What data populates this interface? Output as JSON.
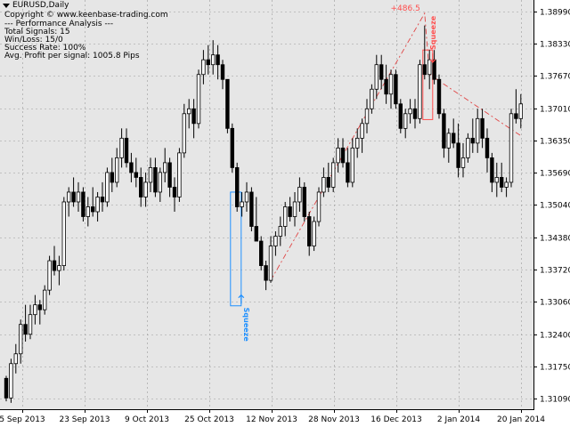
{
  "window": {
    "symbol_timeframe": "EURUSD,Daily"
  },
  "info_panel": {
    "copyright": "Copyright © www.keenbase-trading.com",
    "header": "--- Performance Analysis ---",
    "total_signals": "Total Signals: 15",
    "win_loss": "Win/Loss: 15/0",
    "success_rate": "Success Rate: 100%",
    "avg_profit": "Avg. Profit per signal: 1005.8 Pips"
  },
  "colors": {
    "background": "#e6e6e6",
    "grid": "#9a9a9a",
    "candle": "#000000",
    "bull_signal": "#1e90ff",
    "bear_signal": "#ff4d4d"
  },
  "chart_data": {
    "type": "candlestick",
    "title": "EURUSD,Daily",
    "x_tick_labels": [
      "5 Sep 2013",
      "23 Sep 2013",
      "9 Oct 2013",
      "25 Oct 2013",
      "12 Nov 2013",
      "28 Nov 2013",
      "16 Dec 2013",
      "2 Jan 2014",
      "20 Jan 2014"
    ],
    "y_tick_labels": [
      "1.38990",
      "1.38330",
      "1.37670",
      "1.37010",
      "1.36350",
      "1.35690",
      "1.35040",
      "1.34380",
      "1.33720",
      "1.33060",
      "1.32400",
      "1.31750",
      "1.31090"
    ],
    "y_ticks": [
      1.3899,
      1.3833,
      1.3767,
      1.3701,
      1.3635,
      1.3569,
      1.3504,
      1.3438,
      1.3372,
      1.3306,
      1.324,
      1.3175,
      1.3109
    ],
    "ylim": [
      1.3087,
      1.3922
    ],
    "grid": true,
    "candles": [
      [
        1.315,
        1.3155,
        1.3103,
        1.311
      ],
      [
        1.311,
        1.319,
        1.31,
        1.318
      ],
      [
        1.318,
        1.322,
        1.316,
        1.32
      ],
      [
        1.32,
        1.327,
        1.318,
        1.326
      ],
      [
        1.326,
        1.33,
        1.3225,
        1.324
      ],
      [
        1.324,
        1.33,
        1.323,
        1.328
      ],
      [
        1.328,
        1.332,
        1.326,
        1.33
      ],
      [
        1.33,
        1.331,
        1.326,
        1.329
      ],
      [
        1.329,
        1.334,
        1.328,
        1.333
      ],
      [
        1.333,
        1.34,
        1.332,
        1.339
      ],
      [
        1.339,
        1.342,
        1.336,
        1.337
      ],
      [
        1.337,
        1.34,
        1.334,
        1.338
      ],
      [
        1.338,
        1.352,
        1.337,
        1.351
      ],
      [
        1.351,
        1.354,
        1.348,
        1.353
      ],
      [
        1.353,
        1.356,
        1.35,
        1.351
      ],
      [
        1.351,
        1.355,
        1.349,
        1.353
      ],
      [
        1.353,
        1.354,
        1.347,
        1.348
      ],
      [
        1.348,
        1.352,
        1.346,
        1.35
      ],
      [
        1.35,
        1.354,
        1.348,
        1.349
      ],
      [
        1.349,
        1.353,
        1.347,
        1.352
      ],
      [
        1.352,
        1.355,
        1.349,
        1.351
      ],
      [
        1.351,
        1.358,
        1.35,
        1.357
      ],
      [
        1.357,
        1.36,
        1.353,
        1.355
      ],
      [
        1.355,
        1.362,
        1.354,
        1.36
      ],
      [
        1.36,
        1.366,
        1.358,
        1.364
      ],
      [
        1.364,
        1.366,
        1.358,
        1.359
      ],
      [
        1.359,
        1.361,
        1.355,
        1.357
      ],
      [
        1.357,
        1.36,
        1.354,
        1.356
      ],
      [
        1.356,
        1.358,
        1.35,
        1.352
      ],
      [
        1.352,
        1.357,
        1.35,
        1.355
      ],
      [
        1.355,
        1.36,
        1.353,
        1.358
      ],
      [
        1.358,
        1.36,
        1.352,
        1.353
      ],
      [
        1.353,
        1.358,
        1.351,
        1.357
      ],
      [
        1.357,
        1.362,
        1.355,
        1.359
      ],
      [
        1.359,
        1.36,
        1.352,
        1.354
      ],
      [
        1.354,
        1.356,
        1.349,
        1.352
      ],
      [
        1.352,
        1.362,
        1.351,
        1.361
      ],
      [
        1.361,
        1.371,
        1.36,
        1.369
      ],
      [
        1.369,
        1.372,
        1.366,
        1.37
      ],
      [
        1.37,
        1.372,
        1.364,
        1.367
      ],
      [
        1.367,
        1.378,
        1.366,
        1.377
      ],
      [
        1.377,
        1.382,
        1.375,
        1.38
      ],
      [
        1.38,
        1.383,
        1.377,
        1.379
      ],
      [
        1.379,
        1.384,
        1.377,
        1.381
      ],
      [
        1.381,
        1.383,
        1.376,
        1.379
      ],
      [
        1.379,
        1.38,
        1.374,
        1.376
      ],
      [
        1.376,
        1.376,
        1.365,
        1.366
      ],
      [
        1.366,
        1.367,
        1.357,
        1.358
      ],
      [
        1.358,
        1.359,
        1.349,
        1.35
      ],
      [
        1.35,
        1.353,
        1.348,
        1.351
      ],
      [
        1.351,
        1.355,
        1.349,
        1.353
      ],
      [
        1.353,
        1.354,
        1.345,
        1.346
      ],
      [
        1.346,
        1.352,
        1.344,
        1.343
      ],
      [
        1.343,
        1.344,
        1.337,
        1.338
      ],
      [
        1.338,
        1.339,
        1.333,
        1.335
      ],
      [
        1.335,
        1.344,
        1.3345,
        1.342
      ],
      [
        1.342,
        1.345,
        1.34,
        1.344
      ],
      [
        1.344,
        1.348,
        1.342,
        1.346
      ],
      [
        1.346,
        1.351,
        1.344,
        1.35
      ],
      [
        1.35,
        1.352,
        1.347,
        1.348
      ],
      [
        1.348,
        1.353,
        1.346,
        1.351
      ],
      [
        1.351,
        1.356,
        1.349,
        1.354
      ],
      [
        1.354,
        1.355,
        1.347,
        1.348
      ],
      [
        1.348,
        1.349,
        1.34,
        1.342
      ],
      [
        1.342,
        1.348,
        1.341,
        1.347
      ],
      [
        1.347,
        1.354,
        1.346,
        1.353
      ],
      [
        1.353,
        1.358,
        1.352,
        1.356
      ],
      [
        1.356,
        1.359,
        1.353,
        1.354
      ],
      [
        1.354,
        1.36,
        1.353,
        1.359
      ],
      [
        1.359,
        1.364,
        1.357,
        1.362
      ],
      [
        1.362,
        1.364,
        1.358,
        1.359
      ],
      [
        1.359,
        1.362,
        1.354,
        1.355
      ],
      [
        1.355,
        1.364,
        1.354,
        1.362
      ],
      [
        1.362,
        1.366,
        1.36,
        1.364
      ],
      [
        1.364,
        1.368,
        1.361,
        1.367
      ],
      [
        1.367,
        1.372,
        1.365,
        1.37
      ],
      [
        1.37,
        1.375,
        1.369,
        1.374
      ],
      [
        1.374,
        1.381,
        1.372,
        1.379
      ],
      [
        1.379,
        1.381,
        1.374,
        1.376
      ],
      [
        1.376,
        1.379,
        1.371,
        1.373
      ],
      [
        1.373,
        1.378,
        1.37,
        1.377
      ],
      [
        1.377,
        1.378,
        1.37,
        1.371
      ],
      [
        1.371,
        1.372,
        1.365,
        1.366
      ],
      [
        1.366,
        1.37,
        1.364,
        1.369
      ],
      [
        1.369,
        1.372,
        1.367,
        1.37
      ],
      [
        1.37,
        1.372,
        1.366,
        1.368
      ],
      [
        1.368,
        1.38,
        1.367,
        1.379
      ],
      [
        1.379,
        1.387,
        1.376,
        1.377
      ],
      [
        1.377,
        1.382,
        1.374,
        1.38
      ],
      [
        1.38,
        1.382,
        1.375,
        1.376
      ],
      [
        1.376,
        1.377,
        1.368,
        1.369
      ],
      [
        1.369,
        1.37,
        1.36,
        1.362
      ],
      [
        1.362,
        1.366,
        1.359,
        1.365
      ],
      [
        1.365,
        1.368,
        1.362,
        1.363
      ],
      [
        1.363,
        1.367,
        1.356,
        1.358
      ],
      [
        1.358,
        1.363,
        1.356,
        1.36
      ],
      [
        1.36,
        1.365,
        1.359,
        1.364
      ],
      [
        1.364,
        1.368,
        1.361,
        1.363
      ],
      [
        1.363,
        1.37,
        1.361,
        1.368
      ],
      [
        1.368,
        1.37,
        1.362,
        1.364
      ],
      [
        1.364,
        1.366,
        1.357,
        1.36
      ],
      [
        1.36,
        1.361,
        1.353,
        1.355
      ],
      [
        1.355,
        1.359,
        1.352,
        1.356
      ],
      [
        1.356,
        1.359,
        1.353,
        1.354
      ],
      [
        1.354,
        1.356,
        1.352,
        1.355
      ],
      [
        1.355,
        1.37,
        1.354,
        1.369
      ],
      [
        1.369,
        1.374,
        1.367,
        1.368
      ],
      [
        1.368,
        1.373,
        1.366,
        1.371
      ]
    ],
    "signals": [
      {
        "name": "Squeeze",
        "direction": "buy",
        "box_high": 1.353,
        "box_low": 1.3298,
        "arrow_price": 1.332
      },
      {
        "name": "Squeeze",
        "direction": "sell",
        "box_high": 1.382,
        "box_low": 1.3678,
        "arrow_price": 1.3795,
        "profit_label": "+486.5"
      }
    ],
    "trend_line": [
      {
        "index": 55,
        "price": 1.335
      },
      {
        "index": 87,
        "price": 1.3895
      },
      {
        "index": 88,
        "price": 1.377
      },
      {
        "index": 107,
        "price": 1.3645
      }
    ]
  }
}
